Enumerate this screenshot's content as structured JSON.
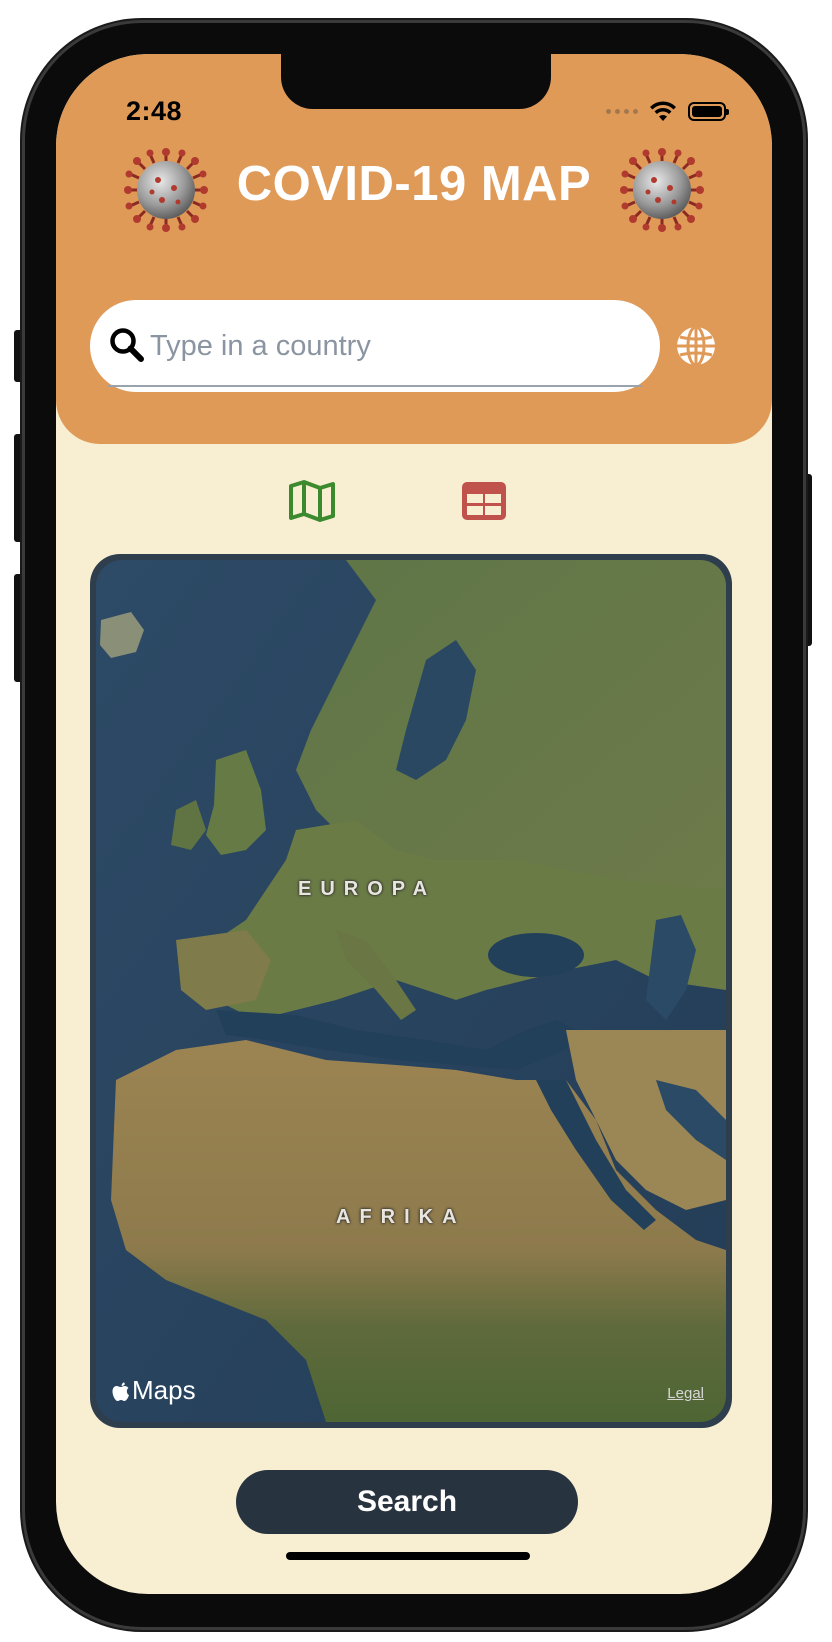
{
  "status_bar": {
    "time": "2:48"
  },
  "header": {
    "title": "COVID-19 MAP"
  },
  "search": {
    "placeholder": "Type in a country",
    "value": ""
  },
  "view_toggle": {
    "map_icon": "map-icon",
    "table_icon": "table-icon",
    "active": "map"
  },
  "map": {
    "labels": {
      "europe": "EUROPA",
      "africa": "AFRIKA"
    },
    "brand": "Maps",
    "legal": "Legal"
  },
  "footer": {
    "search_button_label": "Search"
  },
  "colors": {
    "header_bg": "#e09a58",
    "page_bg": "#f8efd3",
    "button_bg": "#283340",
    "map_toggle": "#3c8a2e",
    "table_toggle": "#c0524c"
  }
}
